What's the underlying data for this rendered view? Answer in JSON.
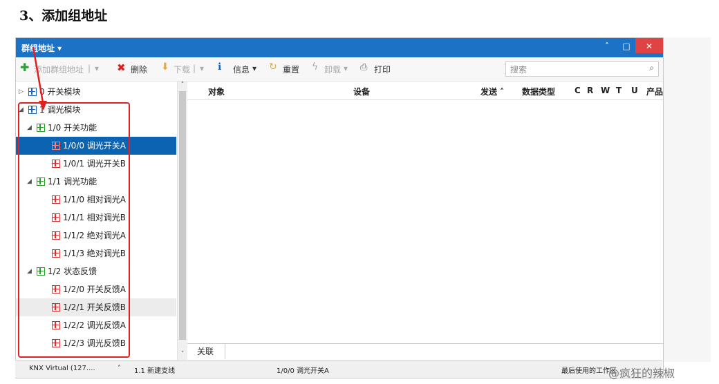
{
  "heading": "3、添加组地址",
  "window": {
    "title": "群组地址 ▾",
    "controls": {
      "min": "˄",
      "max": "□",
      "close": "✕"
    }
  },
  "toolbar": {
    "add": "添加群组地址",
    "add_menu": "▾",
    "delete": "删除",
    "download": "下载",
    "download_menu": "▾",
    "info": "信息",
    "info_menu": "▾",
    "reset": "重置",
    "unload": "卸载",
    "unload_menu": "▾",
    "print": "打印",
    "search_placeholder": "搜索"
  },
  "tree": [
    {
      "label": "0 开关模块",
      "level": 0,
      "toggle": "▷",
      "color": "blue"
    },
    {
      "label": "1 调光模块",
      "level": 0,
      "toggle": "◢",
      "color": "blue"
    },
    {
      "label": "1/0 开关功能",
      "level": 1,
      "toggle": "◢",
      "color": "green"
    },
    {
      "label": "1/0/0 调光开关A",
      "level": 2,
      "toggle": "",
      "color": "red",
      "selected": true
    },
    {
      "label": "1/0/1 调光开关B",
      "level": 2,
      "toggle": "",
      "color": "red"
    },
    {
      "label": "1/1 调光功能",
      "level": 1,
      "toggle": "◢",
      "color": "green"
    },
    {
      "label": "1/1/0 相对调光A",
      "level": 2,
      "toggle": "",
      "color": "red"
    },
    {
      "label": "1/1/1 相对调光B",
      "level": 2,
      "toggle": "",
      "color": "red"
    },
    {
      "label": "1/1/2 绝对调光A",
      "level": 2,
      "toggle": "",
      "color": "red"
    },
    {
      "label": "1/1/3 绝对调光B",
      "level": 2,
      "toggle": "",
      "color": "red"
    },
    {
      "label": "1/2 状态反馈",
      "level": 1,
      "toggle": "◢",
      "color": "green"
    },
    {
      "label": "1/2/0 开关反馈A",
      "level": 2,
      "toggle": "",
      "color": "red"
    },
    {
      "label": "1/2/1 开关反馈B",
      "level": 2,
      "toggle": "",
      "color": "red",
      "hover": true
    },
    {
      "label": "1/2/2 调光反馈A",
      "level": 2,
      "toggle": "",
      "color": "red"
    },
    {
      "label": "1/2/3 调光反馈B",
      "level": 2,
      "toggle": "",
      "color": "red"
    }
  ],
  "grid": {
    "columns": [
      "对象",
      "设备",
      "发送 ˄",
      "数据类型",
      "C",
      "R",
      "W",
      "T",
      "U",
      "产品"
    ]
  },
  "bottom_tab": "关联",
  "status": {
    "connection": "KNX Virtual  (127....",
    "caret": "˄",
    "line": "1.1 新建支线",
    "selected": "1/0/0 调光开关A",
    "recent": "最后使用的工作区"
  },
  "watermark": "@疯狂的辣椒",
  "colors": {
    "title_bar": "#1c73c5",
    "selection": "#0b63b2",
    "annotation": "#e02020"
  }
}
